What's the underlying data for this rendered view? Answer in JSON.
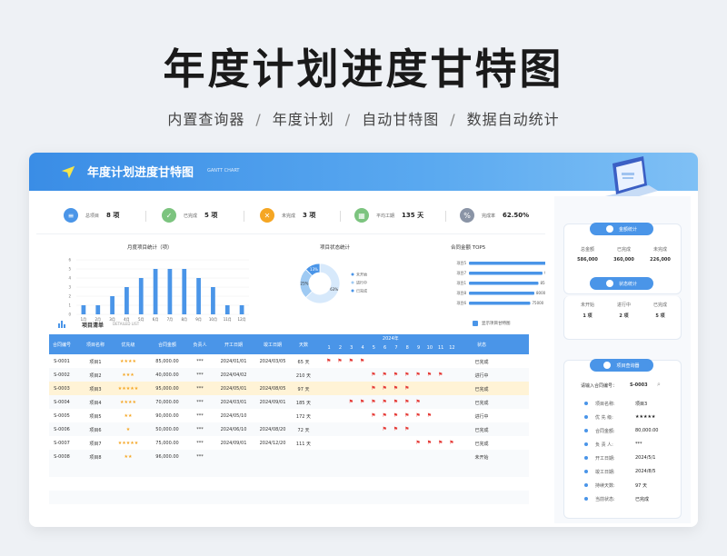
{
  "hero": {
    "title": "年度计划进度甘特图",
    "tags": [
      "内置查询器",
      "年度计划",
      "自动甘特图",
      "数据自动统计"
    ]
  },
  "banner": {
    "title": "年度计划进度甘特图",
    "subtitle": "GANTT CHART"
  },
  "stats": [
    {
      "label": "总项目",
      "value": "8 项",
      "icon": "list-icon",
      "color": "#4a95e8"
    },
    {
      "label": "已完成",
      "value": "5 项",
      "icon": "check-icon",
      "color": "#7cc47f"
    },
    {
      "label": "未完成",
      "value": "3 项",
      "icon": "x-icon",
      "color": "#f5a623"
    },
    {
      "label": "平均工期",
      "value": "135 天",
      "icon": "calendar-icon",
      "color": "#7cc47f"
    },
    {
      "label": "完成率",
      "value": "62.50%",
      "icon": "percent-icon",
      "color": "#8a94a6"
    }
  ],
  "monthly_chart": {
    "title": "月度项目统计（项）",
    "categories": [
      "1月",
      "2月",
      "3月",
      "4月",
      "5月",
      "6月",
      "7月",
      "8月",
      "9月",
      "10月",
      "11月",
      "12月"
    ],
    "values": [
      1,
      1,
      2,
      3,
      4,
      5,
      5,
      5,
      4,
      3,
      1,
      1
    ],
    "ylim": [
      0,
      6
    ],
    "yticks": [
      "6",
      "5",
      "4",
      "3",
      "2",
      "1",
      "0"
    ],
    "color": "#4a95e8"
  },
  "status_chart": {
    "title": "项目状态统计",
    "labels": [
      "63%",
      "25%",
      "13%"
    ],
    "legend": [
      "未开始",
      "进行中",
      "已完成"
    ],
    "colors": [
      "#d7e9fb",
      "#9fcaf3",
      "#4a95e8"
    ]
  },
  "amount_chart": {
    "title": "合同金额 TOP5",
    "categories": [
      "项目5",
      "项目7",
      "项目1",
      "项目8",
      "项目6"
    ],
    "values": [
      95000,
      90000,
      85000,
      80000,
      75000
    ],
    "labels": [
      "96000",
      "90000",
      "85000",
      "80000",
      "75000"
    ],
    "color": "#4a95e8"
  },
  "list": {
    "title": "项目清单",
    "subtitle": "DETAILED LIST",
    "checkbox_label": "显示项目甘特图"
  },
  "table": {
    "headers": [
      "合同编号",
      "项目名称",
      "优先级",
      "合同金额",
      "负责人",
      "开工日期",
      "竣工日期",
      "天数"
    ],
    "gantt_year": "2024年",
    "months": [
      "1",
      "2",
      "3",
      "4",
      "5",
      "6",
      "7",
      "8",
      "9",
      "10",
      "11",
      "12"
    ],
    "status_header": "状态",
    "rows": [
      {
        "id": "S-0001",
        "name": "项目1",
        "stars": "★★★★",
        "amount": "85,000.00",
        "owner": "***",
        "start": "2024/01/01",
        "end": "2024/03/05",
        "days": "65 天",
        "flags": [
          1,
          2,
          3,
          4
        ],
        "status": "已完成",
        "hl": false
      },
      {
        "id": "S-0002",
        "name": "项目2",
        "stars": "★★★",
        "amount": "40,000.00",
        "owner": "***",
        "start": "2024/04/02",
        "end": "",
        "days": "210 天",
        "flags": [
          5,
          6,
          7,
          8,
          9,
          10,
          11
        ],
        "status": "进行中",
        "hl": false
      },
      {
        "id": "S-0003",
        "name": "项目3",
        "stars": "★★★★★",
        "amount": "95,000.00",
        "owner": "***",
        "start": "2024/05/01",
        "end": "2024/08/05",
        "days": "97 天",
        "flags": [
          5,
          6,
          7,
          8
        ],
        "status": "已完成",
        "hl": true
      },
      {
        "id": "S-0004",
        "name": "项目4",
        "stars": "★★★★",
        "amount": "70,000.00",
        "owner": "***",
        "start": "2024/03/01",
        "end": "2024/09/01",
        "days": "185 天",
        "flags": [
          3,
          4,
          5,
          6,
          7,
          8,
          9
        ],
        "status": "已完成",
        "hl": false
      },
      {
        "id": "S-0005",
        "name": "项目5",
        "stars": "★★",
        "amount": "90,000.00",
        "owner": "***",
        "start": "2024/05/10",
        "end": "",
        "days": "172 天",
        "flags": [
          5,
          6,
          7,
          8,
          9,
          10
        ],
        "status": "进行中",
        "hl": false
      },
      {
        "id": "S-0006",
        "name": "项目6",
        "stars": "★",
        "amount": "50,000.00",
        "owner": "***",
        "start": "2024/06/10",
        "end": "2024/08/20",
        "days": "72 天",
        "flags": [
          6,
          7,
          8
        ],
        "status": "已完成",
        "hl": false
      },
      {
        "id": "S-0007",
        "name": "项目7",
        "stars": "★★★★★",
        "amount": "75,000.00",
        "owner": "***",
        "start": "2024/09/01",
        "end": "2024/12/20",
        "days": "111 天",
        "flags": [
          9,
          10,
          11,
          12
        ],
        "status": "已完成",
        "hl": false
      },
      {
        "id": "S-0008",
        "name": "项目8",
        "stars": "★★",
        "amount": "96,000.00",
        "owner": "***",
        "start": "",
        "end": "",
        "days": "",
        "flags": [],
        "status": "未开始",
        "hl": false
      }
    ]
  },
  "side": {
    "amount_panel": {
      "title": "金额统计",
      "labels": [
        "总金额",
        "已完成",
        "未完成"
      ],
      "values": [
        "586,000",
        "360,000",
        "226,000"
      ]
    },
    "status_panel": {
      "title": "状态统计",
      "labels": [
        "未开始",
        "进行中",
        "已完成"
      ],
      "values": [
        "1 项",
        "2 项",
        "5 项"
      ]
    },
    "query_panel": {
      "title": "项目查询器",
      "prompt": "请输入合同编号：",
      "query": "S-0003",
      "fields": [
        {
          "k": "项目名称:",
          "v": "项目3"
        },
        {
          "k": "优 先 级:",
          "v": "★★★★★"
        },
        {
          "k": "合同金额:",
          "v": "80,000.00"
        },
        {
          "k": "负 责 人:",
          "v": "***"
        },
        {
          "k": "开工日期:",
          "v": "2024/5/1"
        },
        {
          "k": "竣工日期:",
          "v": "2024/8/5"
        },
        {
          "k": "持续天数:",
          "v": "97 天"
        },
        {
          "k": "当前状态:",
          "v": "已完成"
        }
      ]
    }
  }
}
